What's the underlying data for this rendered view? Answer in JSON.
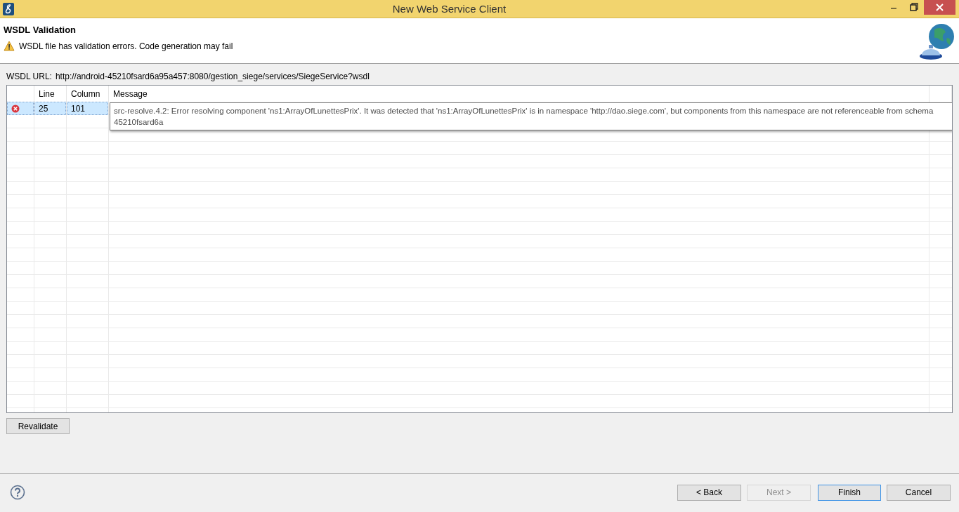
{
  "window": {
    "title": "New Web Service Client"
  },
  "header": {
    "title": "WSDL Validation",
    "message": "WSDL file has validation errors. Code generation may fail",
    "kind": "warning"
  },
  "wsdl_url": {
    "label": "WSDL URL:",
    "value": "http://android-45210fsard6a95a457:8080/gestion_siege/services/SiegeService?wsdl"
  },
  "table": {
    "columns": [
      "Line",
      "Column",
      "Message"
    ],
    "rows": [
      {
        "kind": "error",
        "line": "25",
        "column": "101",
        "selected": true
      }
    ]
  },
  "tooltip": {
    "lines": [
      "src-resolve.4.2: Error resolving component 'ns1:ArrayOfLunettesPrix'. It was detected that 'ns1:ArrayOfLunettesPrix' is in namespace 'http://dao.siege.com', but components from this namespace are not referenceable from schema",
      "45210fsard6a"
    ]
  },
  "revalidate_button": "Revalidate",
  "buttons": [
    {
      "label": "< Back",
      "disabled": false,
      "default": false
    },
    {
      "label": "Next >",
      "disabled": true,
      "default": false
    },
    {
      "label": "Finish",
      "disabled": false,
      "default": true
    },
    {
      "label": "Cancel",
      "disabled": false,
      "default": false
    }
  ]
}
